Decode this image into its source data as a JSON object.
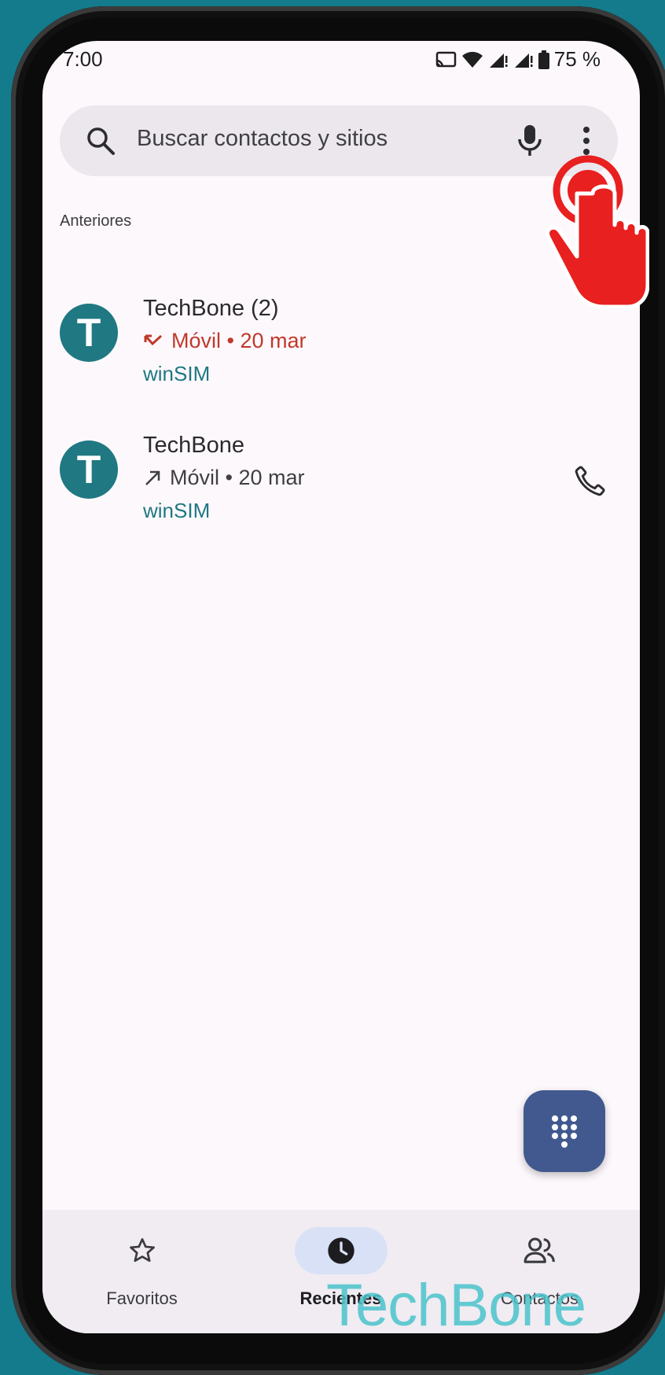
{
  "status_bar": {
    "time": "7:00",
    "battery": "75 %"
  },
  "search": {
    "placeholder": "Buscar contactos y sitios"
  },
  "section": {
    "title": "Anteriores"
  },
  "calls": [
    {
      "avatar_letter": "T",
      "name": "TechBone  (2)",
      "type": "missed",
      "detail": "Móvil • 20 mar",
      "sim": "winSIM"
    },
    {
      "avatar_letter": "T",
      "name": "TechBone",
      "type": "outgoing",
      "detail": "Móvil • 20 mar",
      "sim": "winSIM"
    }
  ],
  "bottom_nav": {
    "favorites": "Favoritos",
    "recents": "Recientes",
    "contacts": "Contactos"
  },
  "watermark": "TechBone",
  "colors": {
    "background": "#137b8c",
    "accent": "#1f7882",
    "missed": "#c0392b",
    "fab": "#41598f"
  }
}
